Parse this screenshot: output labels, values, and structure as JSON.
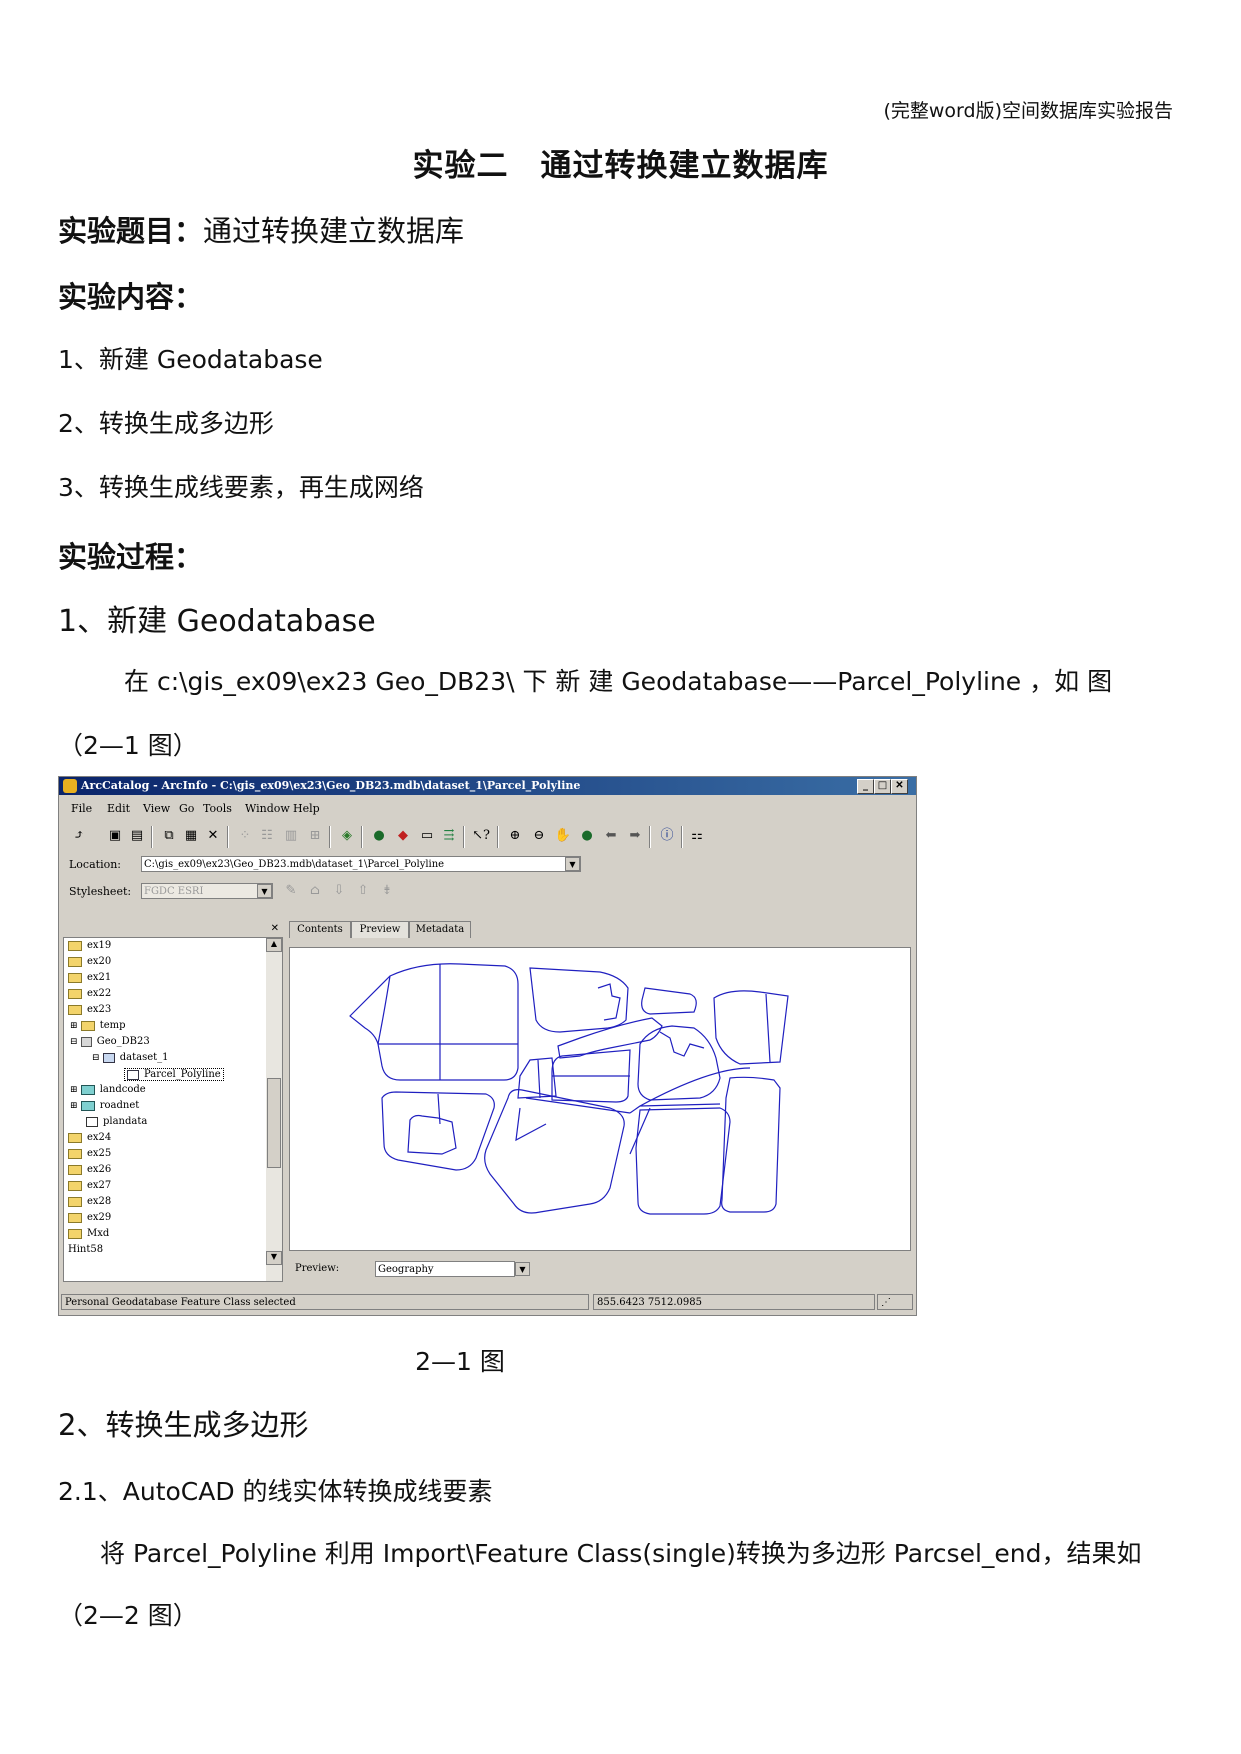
{
  "header": "(完整word版)空间数据库实验报告",
  "title": "实验二　通过转换建立数据库",
  "topic_label": "实验题目：",
  "topic_value": "通过转换建立数据库",
  "content_label": "实验内容：",
  "content_items": [
    "1、新建 Geodatabase",
    "2、转换生成多边形",
    "3、转换生成线要素，再生成网络"
  ],
  "process_label": "实验过程：",
  "step1_heading": "1、新建 Geodatabase",
  "step1_para": "在 c:\\gis_ex09\\ex23 Geo_DB23\\ 下 新 建 Geodatabase——Parcel_Polyline ，如 图",
  "step1_para_cont": "（2—1 图）",
  "screenshot": {
    "title": "ArcCatalog - ArcInfo - C:\\gis_ex09\\ex23\\Geo_DB23.mdb\\dataset_1\\Parcel_Polyline",
    "menus": [
      "File",
      "Edit",
      "View",
      "Go",
      "Tools",
      "Window",
      "Help"
    ],
    "location_label": "Location:",
    "location_value": "C:\\gis_ex09\\ex23\\Geo_DB23.mdb\\dataset_1\\Parcel_Polyline",
    "stylesheet_label": "Stylesheet:",
    "stylesheet_value": "FGDC ESRI",
    "tree": [
      "ex19",
      "ex20",
      "ex21",
      "ex22",
      "ex23",
      "temp",
      "Geo_DB23",
      "dataset_1",
      "Parcel_Polyline",
      "landcode",
      "roadnet",
      "plandata",
      "ex24",
      "ex25",
      "ex26",
      "ex27",
      "ex28",
      "ex29",
      "Mxd",
      "Hint58"
    ],
    "tabs": [
      "Contents",
      "Preview",
      "Metadata"
    ],
    "preview_label": "Preview:",
    "preview_value": "Geography",
    "status_text": "Personal Geodatabase Feature Class selected",
    "coords": "855.6423   7512.0985",
    "line_color": "#2020c0"
  },
  "fig1_caption": "2—1  图",
  "step2_heading": "2、转换生成多边形",
  "step21_heading": "2.1、AutoCAD 的线实体转换成线要素",
  "step2_para": "将 Parcel_Polyline 利用 Import\\Feature Class(single)转换为多边形 Parcsel_end，结果如",
  "step2_para_cont": "（2—2 图）"
}
